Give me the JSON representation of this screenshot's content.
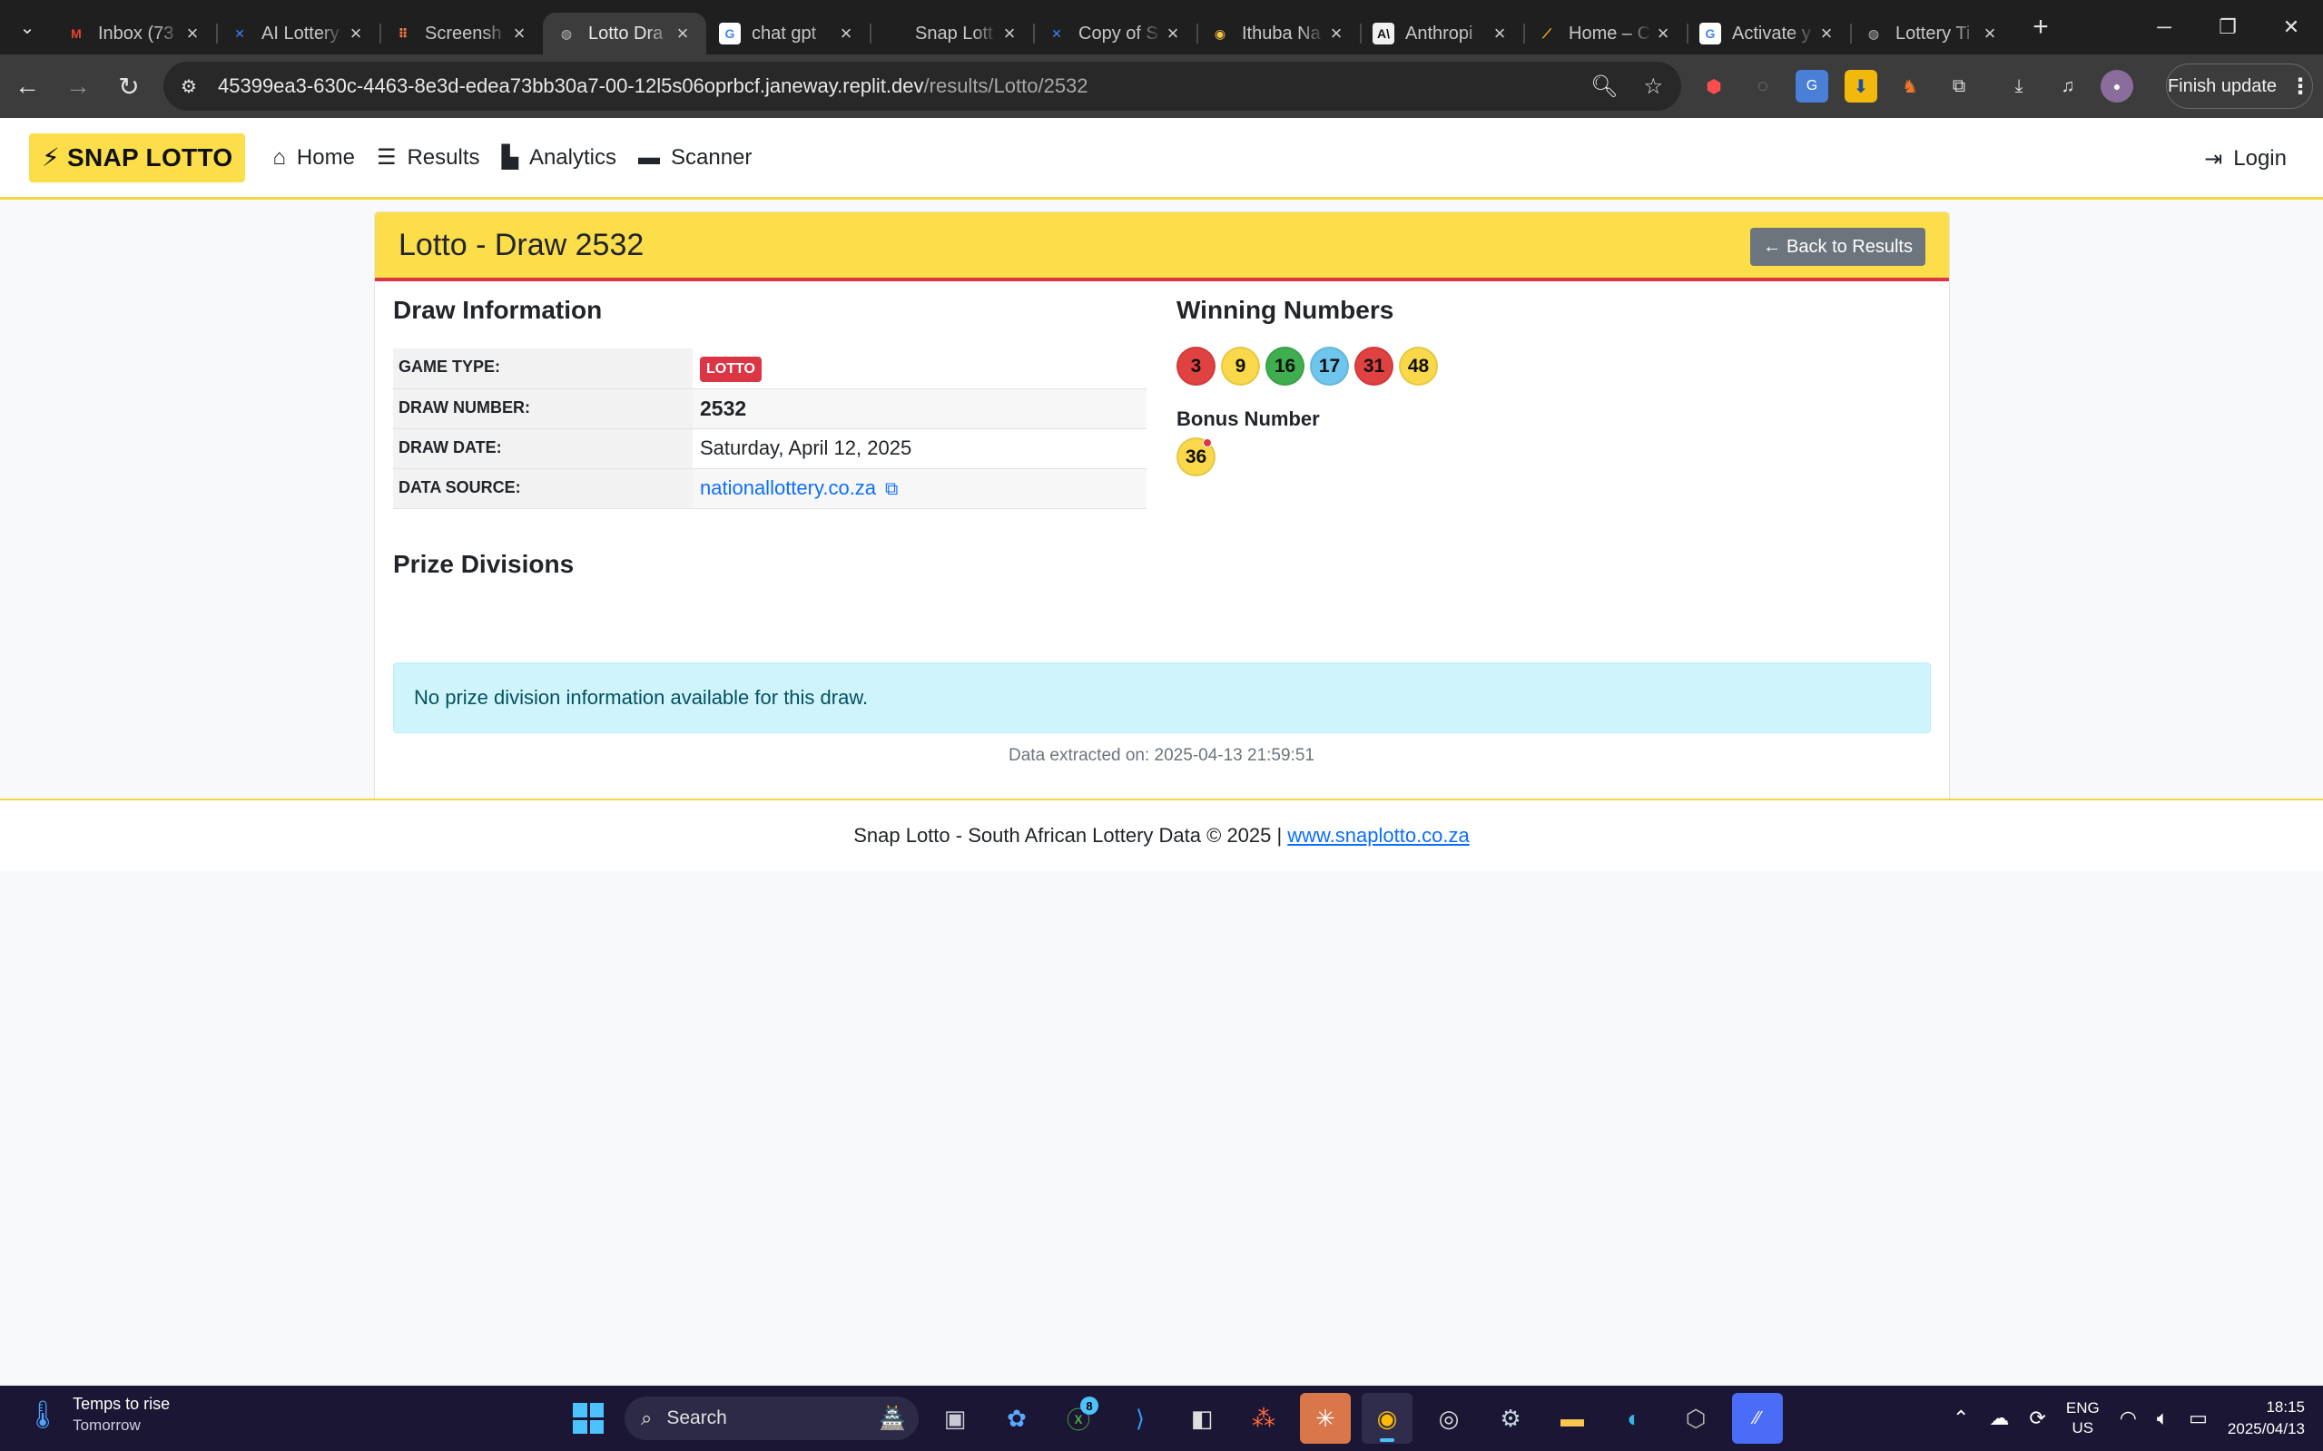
{
  "browser": {
    "tabs": [
      {
        "title": "Inbox (73",
        "favicon": "M",
        "fav_color": "#ea4335",
        "fav_bg": "transparent"
      },
      {
        "title": "AI Lottery",
        "favicon": "✕",
        "fav_color": "#3b82f6",
        "fav_bg": "transparent"
      },
      {
        "title": "Screensh",
        "favicon": "⠿",
        "fav_color": "#ff7a45",
        "fav_bg": "transparent"
      },
      {
        "title": "Lotto Dra",
        "favicon": "◍",
        "fav_color": "#bdbdbd",
        "fav_bg": "transparent",
        "active": true
      },
      {
        "title": "chat gpt",
        "favicon": "G",
        "fav_color": "#4285f4",
        "fav_bg": "#ffffff"
      },
      {
        "title": "Snap Lott",
        "favicon": "",
        "fav_color": "#bdbdbd",
        "fav_bg": "transparent"
      },
      {
        "title": "Copy of S",
        "favicon": "✕",
        "fav_color": "#3b82f6",
        "fav_bg": "transparent"
      },
      {
        "title": "Ithuba Na",
        "favicon": "◉",
        "fav_color": "#f5c542",
        "fav_bg": "transparent"
      },
      {
        "title": "Anthropi",
        "favicon": "A\\",
        "fav_color": "#111111",
        "fav_bg": "#f0f0f0"
      },
      {
        "title": "Home – C",
        "favicon": "⟋",
        "fav_color": "#fbbc04",
        "fav_bg": "transparent"
      },
      {
        "title": "Activate y",
        "favicon": "G",
        "fav_color": "#4285f4",
        "fav_bg": "#ffffff"
      },
      {
        "title": "Lottery Ti",
        "favicon": "◍",
        "fav_color": "#bdbdbd",
        "fav_bg": "transparent"
      }
    ],
    "url_host": "45399ea3-630c-4463-8e3d-edea73bb30a7-00-12l5s06oprbcf.janeway.replit.dev",
    "url_path": "/results/Lotto/2532",
    "finish_update": "Finish update"
  },
  "navbar": {
    "brand": "SNAP LOTTO",
    "links": [
      {
        "label": "Home",
        "icon": "home-icon"
      },
      {
        "label": "Results",
        "icon": "list-icon"
      },
      {
        "label": "Analytics",
        "icon": "chart-icon"
      },
      {
        "label": "Scanner",
        "icon": "ticket-icon"
      }
    ],
    "login": "Login"
  },
  "draw": {
    "title": "Lotto - Draw 2532",
    "back_label": "Back to Results",
    "info_title": "Draw Information",
    "rows": {
      "game_type_label": "GAME TYPE:",
      "game_type_value": "LOTTO",
      "draw_number_label": "DRAW NUMBER:",
      "draw_number_value": "2532",
      "draw_date_label": "DRAW DATE:",
      "draw_date_value": "Saturday, April 12, 2025",
      "data_source_label": "DATA SOURCE:",
      "data_source_value": "nationallottery.co.za"
    },
    "winning_title": "Winning Numbers",
    "winning_numbers": [
      {
        "n": "3",
        "color": "#e04141"
      },
      {
        "n": "9",
        "color": "#f9d94a"
      },
      {
        "n": "16",
        "color": "#3fae4f"
      },
      {
        "n": "17",
        "color": "#6ec6ec"
      },
      {
        "n": "31",
        "color": "#e04141"
      },
      {
        "n": "48",
        "color": "#f9d94a"
      }
    ],
    "bonus_title": "Bonus Number",
    "bonus_number": {
      "n": "36",
      "color": "#f9d94a"
    },
    "prize_title": "Prize Divisions",
    "prize_message": "No prize division information available for this draw."
  },
  "extracted": "Data extracted on: 2025-04-13 21:59:51",
  "footer": {
    "text": "Snap Lotto - South African Lottery Data © 2025 |",
    "link": "www.snaplotto.co.za"
  },
  "taskbar": {
    "weather_line1": "Temps to rise",
    "weather_line2": "Tomorrow",
    "search_placeholder": "Search",
    "lang_line1": "ENG",
    "lang_line2": "US",
    "time": "18:15",
    "date": "2025/04/13",
    "xbox_badge": "8"
  }
}
